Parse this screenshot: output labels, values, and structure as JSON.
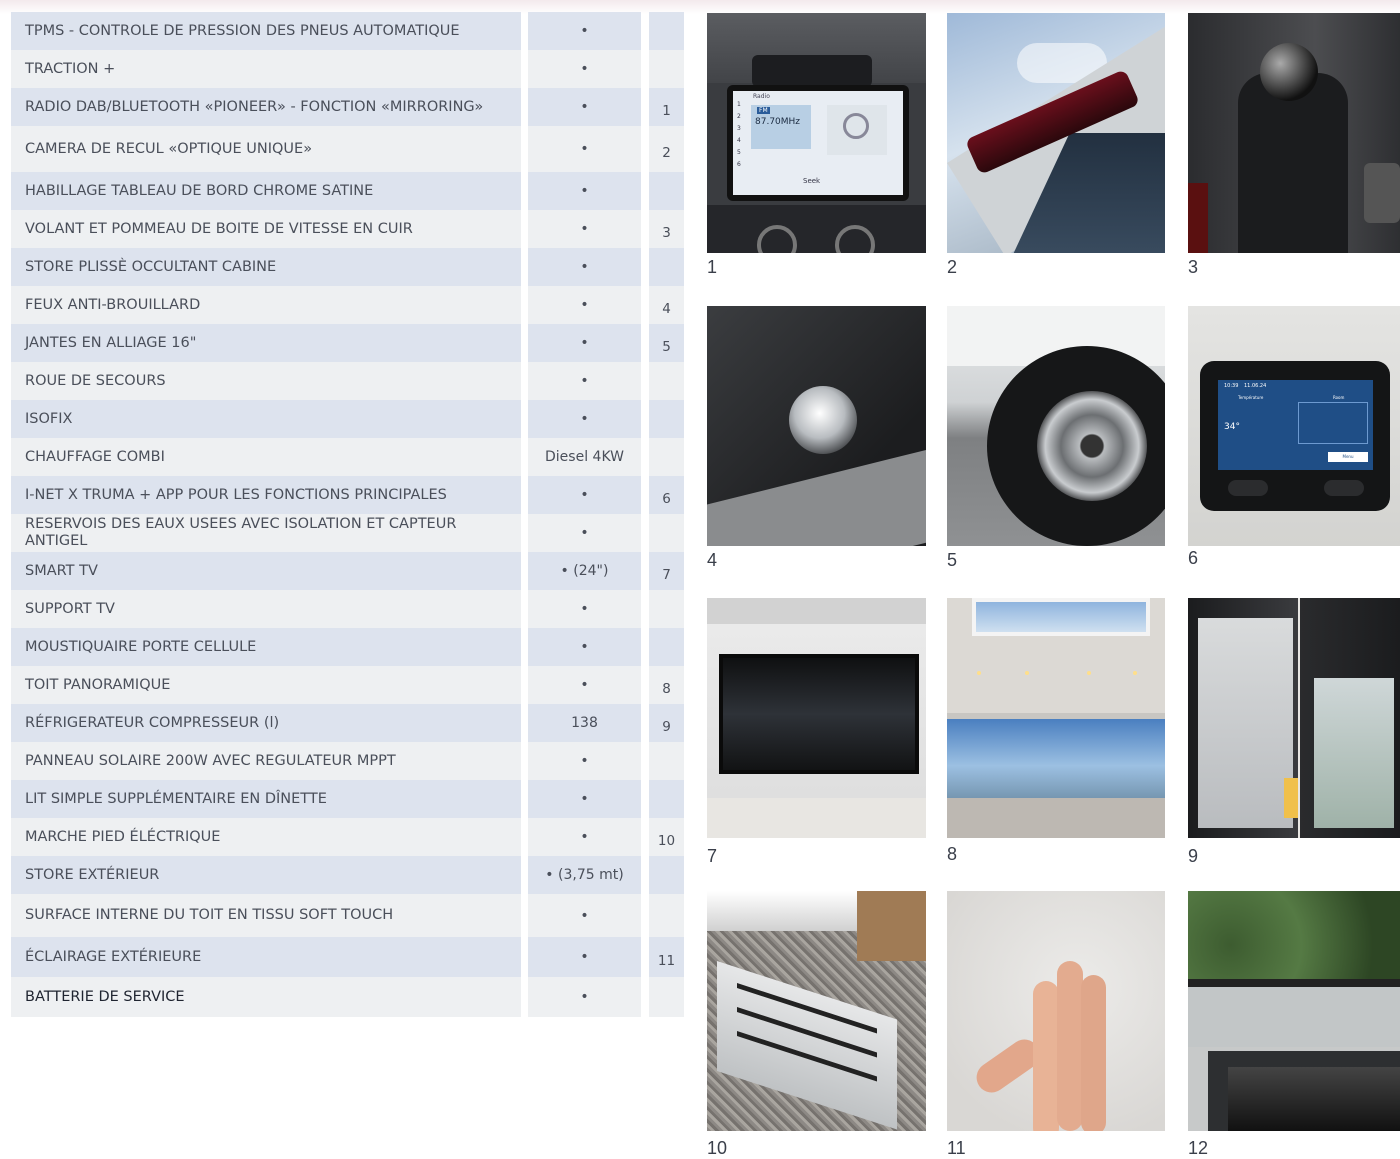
{
  "table": {
    "rows": [
      {
        "label": "TPMS - CONTROLE DE PRESSION DES PNEUS AUTOMATIQUE",
        "value": "•",
        "ref": ""
      },
      {
        "label": "TRACTION +",
        "value": "•",
        "ref": ""
      },
      {
        "label": "RADIO DAB/BLUETOOTH «PIONEER» - FONCTION «MIRRORING»",
        "value": "•",
        "ref": "1"
      },
      {
        "label": "CAMERA DE RECUL «OPTIQUE UNIQUE»",
        "value": "•",
        "ref": "2"
      },
      {
        "label": "HABILLAGE TABLEAU DE BORD CHROME SATINE",
        "value": "•",
        "ref": ""
      },
      {
        "label": "VOLANT ET POMMEAU DE BOITE DE VITESSE EN CUIR",
        "value": "•",
        "ref": "3"
      },
      {
        "label": "STORE PLISSÈ OCCULTANT CABINE",
        "value": "•",
        "ref": ""
      },
      {
        "label": "FEUX ANTI-BROUILLARD",
        "value": "•",
        "ref": "4"
      },
      {
        "label": "JANTES EN ALLIAGE 16\"",
        "value": "•",
        "ref": "5"
      },
      {
        "label": "ROUE DE SECOURS",
        "value": "•",
        "ref": ""
      },
      {
        "label": "ISOFIX",
        "value": "•",
        "ref": ""
      },
      {
        "label": "CHAUFFAGE COMBI",
        "value": "Diesel 4KW",
        "ref": ""
      },
      {
        "label": "I-NET X TRUMA + APP POUR LES FONCTIONS PRINCIPALES",
        "value": "•",
        "ref": "6"
      },
      {
        "label": "RESERVOIS DES EAUX USEES AVEC ISOLATION ET CAPTEUR ANTIGEL",
        "value": "•",
        "ref": ""
      },
      {
        "label": "SMART TV",
        "value": "• (24\")",
        "ref": "7"
      },
      {
        "label": "SUPPORT TV",
        "value": "•",
        "ref": ""
      },
      {
        "label": "MOUSTIQUAIRE PORTE CELLULE",
        "value": "•",
        "ref": ""
      },
      {
        "label": "TOIT PANORAMIQUE",
        "value": "•",
        "ref": "8"
      },
      {
        "label": "RÉFRIGERATEUR COMPRESSEUR (l)",
        "value": "138",
        "ref": "9"
      },
      {
        "label": "PANNEAU SOLAIRE 200W AVEC REGULATEUR MPPT",
        "value": "•",
        "ref": ""
      },
      {
        "label": "LIT SIMPLE SUPPLÉMENTAIRE EN DÎNETTE",
        "value": "•",
        "ref": ""
      },
      {
        "label": "MARCHE PIED ÉLÉCTRIQUE",
        "value": "•",
        "ref": "10"
      },
      {
        "label": "STORE EXTÉRIEUR",
        "value": "• (3,75 mt)",
        "ref": ""
      },
      {
        "label": "SURFACE INTERNE DU TOIT EN TISSU SOFT TOUCH",
        "value": "•",
        "ref": ""
      },
      {
        "label": "ÉCLAIRAGE EXTÉRIEURE",
        "value": "•",
        "ref": "11"
      },
      {
        "label": "BATTERIE DE SERVICE",
        "value": "•",
        "ref": ""
      }
    ]
  },
  "photos": [
    {
      "caption": "1",
      "subject": "radio-screen",
      "screen": {
        "band": "FM",
        "frequency": "87.70MHz",
        "button": "Seek",
        "app": "Radio"
      }
    },
    {
      "caption": "2",
      "subject": "rear-camera"
    },
    {
      "caption": "3",
      "subject": "gear-knob"
    },
    {
      "caption": "4",
      "subject": "fog-light"
    },
    {
      "caption": "5",
      "subject": "alloy-wheel"
    },
    {
      "caption": "6",
      "subject": "truma-panel",
      "screen": {
        "clock": "10:39",
        "date": "11.06.24",
        "temperature_label": "Température",
        "temperature": "34°",
        "room_label": "Room",
        "button": "Menu"
      }
    },
    {
      "caption": "7",
      "subject": "smart-tv"
    },
    {
      "caption": "8",
      "subject": "panoramic-roof"
    },
    {
      "caption": "9",
      "subject": "refrigerator"
    },
    {
      "caption": "10",
      "subject": "electric-step"
    },
    {
      "caption": "11",
      "subject": "soft-touch-ceiling"
    },
    {
      "caption": "12",
      "subject": "exterior-lighting"
    }
  ]
}
